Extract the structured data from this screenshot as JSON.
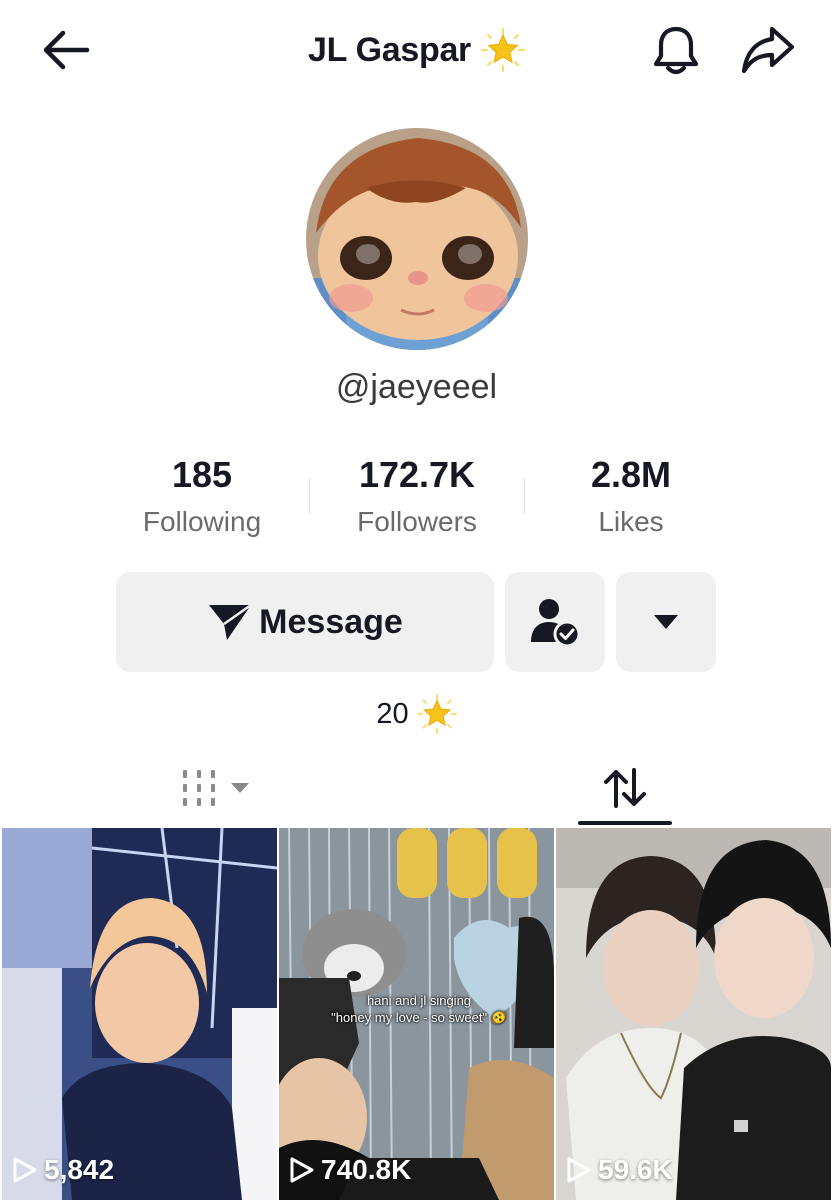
{
  "header": {
    "title": "JL Gaspar",
    "back_icon": "arrow-left-icon",
    "bell_icon": "bell-icon",
    "share_icon": "share-arrow-icon",
    "title_badge_icon": "glowing-star-icon"
  },
  "profile": {
    "handle": "@jaeyeeel",
    "avatar_icon": "profile-avatar"
  },
  "stats": [
    {
      "value": "185",
      "label": "Following"
    },
    {
      "value": "172.7K",
      "label": "Followers"
    },
    {
      "value": "2.8M",
      "label": "Likes"
    }
  ],
  "actions": {
    "message_label": "Message",
    "message_icon": "paper-plane-icon",
    "friend_icon": "user-check-icon",
    "more_icon": "caret-down-icon"
  },
  "subscription": {
    "count": "20",
    "icon": "glowing-star-icon"
  },
  "tabs": {
    "videos_icon": "grid-lines-icon",
    "videos_dropdown_icon": "caret-down-icon",
    "reposts_icon": "repost-arrows-icon",
    "active": "reposts"
  },
  "videos": [
    {
      "views": "5,842"
    },
    {
      "views": "740.8K",
      "caption_line1": "hani and jl singing",
      "caption_line2": "\"honey my love - so sweet\" 🫨"
    },
    {
      "views": "59.6K"
    }
  ],
  "colors": {
    "text": "#161823",
    "muted": "#6b6b6b",
    "button_bg": "#f0f0f0",
    "star": "#f7c21a"
  }
}
